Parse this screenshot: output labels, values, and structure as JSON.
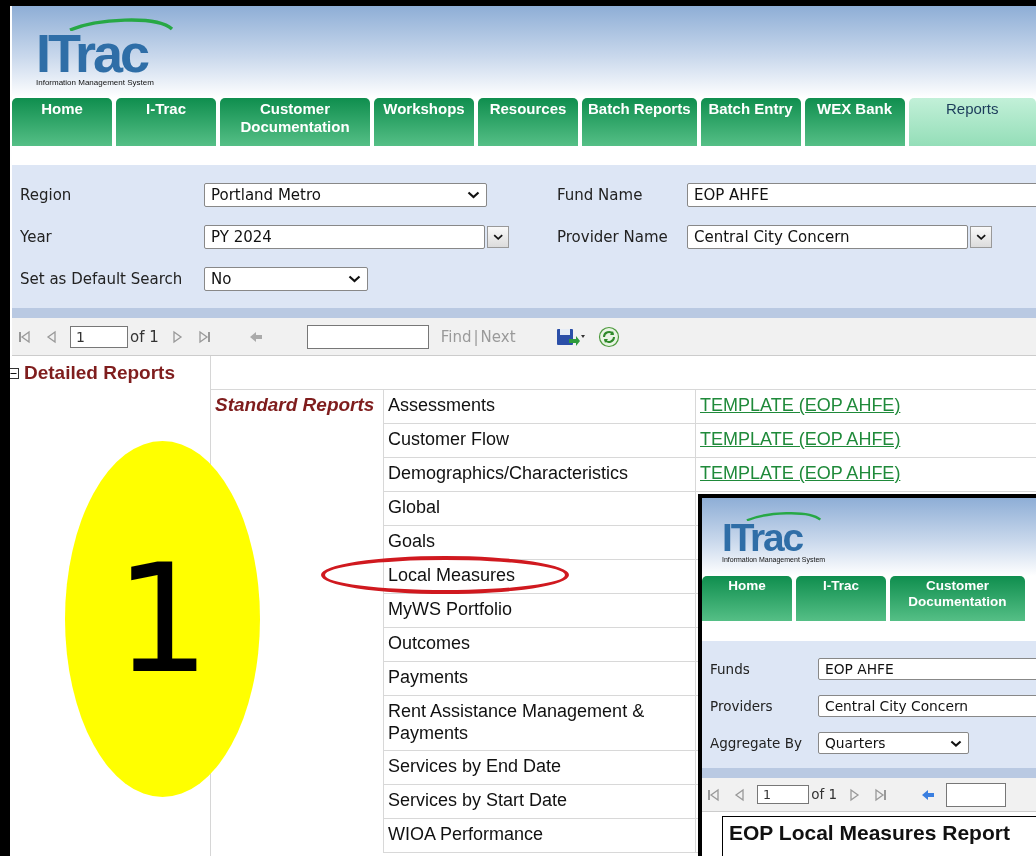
{
  "header": {
    "logo": {
      "wordmark": "ITrac",
      "tagline": "Information Management System"
    }
  },
  "tabs": [
    {
      "label": "Home",
      "selected": false
    },
    {
      "label": "I-Trac",
      "selected": false
    },
    {
      "label": "Customer Documentation",
      "selected": false
    },
    {
      "label": "Workshops",
      "selected": false
    },
    {
      "label": "Resources",
      "selected": false
    },
    {
      "label": "Batch Reports",
      "selected": false
    },
    {
      "label": "Batch Entry",
      "selected": false
    },
    {
      "label": "WEX Bank",
      "selected": false
    },
    {
      "label": "Reports",
      "selected": true
    }
  ],
  "filters": [
    {
      "label": "Region",
      "value": "Portland Metro",
      "kind": "select"
    },
    {
      "label": "Fund Name",
      "value": "EOP AHFE",
      "kind": "text"
    },
    {
      "label": "Year",
      "value": "PY 2024",
      "kind": "combo"
    },
    {
      "label": "Provider Name",
      "value": "Central City Concern",
      "kind": "combo"
    },
    {
      "label": "Set as Default Search",
      "value": "No",
      "kind": "short-select"
    }
  ],
  "toolbar": {
    "page": "1",
    "page_count": "of 1",
    "find": "Find",
    "separator": "|",
    "next": "Next"
  },
  "tree": {
    "label": "Detailed Reports",
    "expanded": true
  },
  "reports": {
    "group": "Standard Reports",
    "items": [
      {
        "name": "Assessments",
        "link": "TEMPLATE (EOP AHFE)",
        "circled": false
      },
      {
        "name": "Customer Flow",
        "link": "TEMPLATE (EOP AHFE)",
        "circled": false
      },
      {
        "name": "Demographics/Characteristics",
        "link": "TEMPLATE (EOP AHFE)",
        "circled": false
      },
      {
        "name": "Global",
        "circled": false
      },
      {
        "name": "Goals",
        "circled": false
      },
      {
        "name": "Local Measures",
        "circled": true
      },
      {
        "name": "MyWS Portfolio",
        "circled": false
      },
      {
        "name": "Outcomes",
        "circled": false
      },
      {
        "name": "Payments",
        "circled": false
      },
      {
        "name": "Rent Assistance Management & Payments",
        "circled": false
      },
      {
        "name": "Services by End Date",
        "circled": false
      },
      {
        "name": "Services by Start Date",
        "circled": false
      },
      {
        "name": "WIOA Performance",
        "circled": false
      }
    ]
  },
  "step_badge": "1",
  "inset": {
    "logo": {
      "wordmark": "ITrac",
      "tagline": "Information Management System"
    },
    "tabs": [
      {
        "label": "Home",
        "selected": false
      },
      {
        "label": "I-Trac",
        "selected": false
      },
      {
        "label": "Customer Documentation",
        "selected": false
      }
    ],
    "filters": [
      {
        "label": "Funds",
        "value": "EOP AHFE",
        "kind": "text"
      },
      {
        "label": "Providers",
        "value": "Central City Concern",
        "kind": "text"
      },
      {
        "label": "Aggregate By",
        "value": "Quarters",
        "kind": "short-select"
      }
    ],
    "toolbar": {
      "page": "1",
      "page_count": "of 1"
    },
    "report_title": "EOP Local Measures Report"
  }
}
